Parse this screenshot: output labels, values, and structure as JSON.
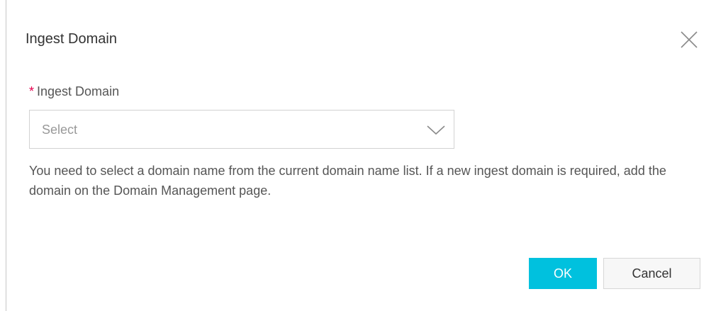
{
  "dialog": {
    "title": "Ingest Domain",
    "close_icon": "close-icon"
  },
  "form": {
    "field_label": "Ingest Domain",
    "required_mark": "*",
    "select_placeholder": "Select",
    "chevron_icon": "chevron-down-icon",
    "help_text": "You need to select a domain name from the current domain name list. If a new ingest domain is required, add the domain on the Domain Management page."
  },
  "footer": {
    "ok_label": "OK",
    "cancel_label": "Cancel"
  },
  "colors": {
    "accent": "#00c1de",
    "required": "#e5004f",
    "text": "#333333",
    "placeholder": "#999999"
  }
}
